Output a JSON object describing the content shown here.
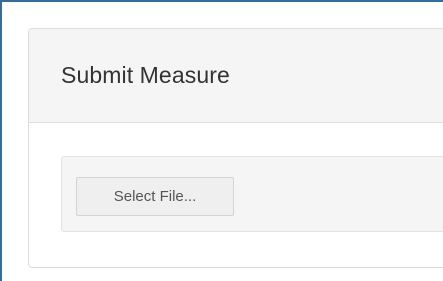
{
  "panel": {
    "title": "Submit Measure"
  },
  "upload": {
    "select_file_label": "Select File..."
  }
}
